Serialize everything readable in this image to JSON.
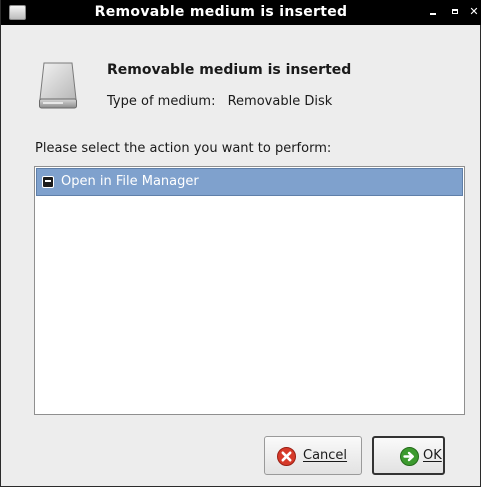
{
  "window": {
    "title": "Removable medium is inserted",
    "controls": {
      "minimize": "minimize-icon",
      "maximize": "maximize-icon",
      "close": "close-icon"
    }
  },
  "header": {
    "title": "Removable medium is inserted",
    "medium_label": "Type of medium:",
    "medium_value": "Removable Disk",
    "icon": "removable-drive-icon"
  },
  "prompt": "Please select the action you want to perform:",
  "actions": [
    {
      "label": "Open in File Manager",
      "icon": "file-manager-icon",
      "selected": true
    }
  ],
  "buttons": {
    "cancel_label": "Cancel",
    "cancel_icon": "cancel-icon",
    "ok_label": "OK",
    "ok_icon": "ok-icon"
  },
  "colors": {
    "titlebar": "#000000",
    "selection": "#7fa1cd",
    "dialog_bg": "#ededed"
  }
}
